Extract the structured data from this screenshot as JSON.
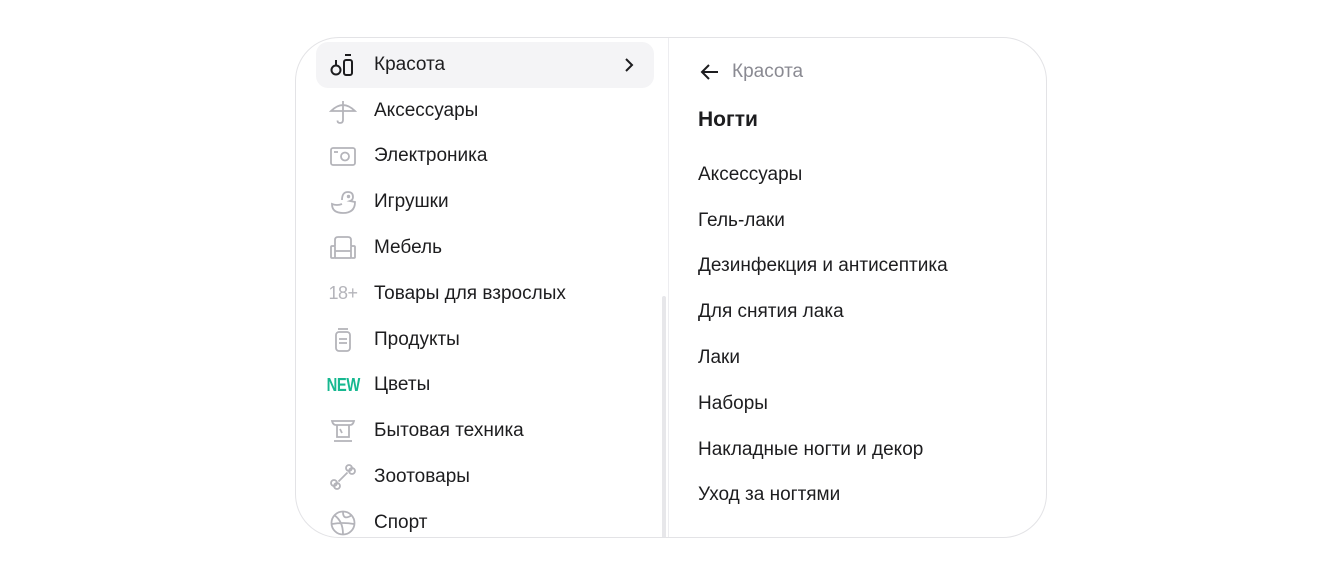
{
  "sidebar": {
    "items": [
      {
        "label": "Красота",
        "icon": "beauty-bottles-icon"
      },
      {
        "label": "Аксессуары",
        "icon": "umbrella-icon"
      },
      {
        "label": "Электроника",
        "icon": "camera-icon"
      },
      {
        "label": "Игрушки",
        "icon": "duck-icon"
      },
      {
        "label": "Мебель",
        "icon": "armchair-icon"
      },
      {
        "label": "Товары для взрослых",
        "icon": "adult-18-icon",
        "badge": "18+"
      },
      {
        "label": "Продукты",
        "icon": "jar-icon"
      },
      {
        "label": "Цветы",
        "icon": "new-badge",
        "badge": "NEW"
      },
      {
        "label": "Бытовая техника",
        "icon": "kitchen-appliance-icon"
      },
      {
        "label": "Зоотовары",
        "icon": "bone-icon"
      },
      {
        "label": "Спорт",
        "icon": "ball-icon"
      }
    ],
    "active_index": 0
  },
  "detail": {
    "back_label": "Красота",
    "title": "Ногти",
    "items": [
      "Аксессуары",
      "Гель-лаки",
      "Дезинфекция и антисептика",
      "Для снятия лака",
      "Лаки",
      "Наборы",
      "Накладные ногти и декор",
      "Уход за ногтями"
    ]
  },
  "colors": {
    "accent_new": "#17b890",
    "icon_gray": "#b4b4ba",
    "active_bg": "#f4f4f6",
    "muted_text": "#8a8a92"
  }
}
